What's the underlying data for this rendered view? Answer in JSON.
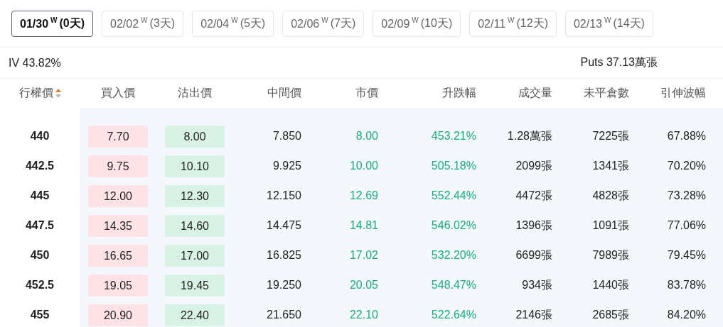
{
  "expiry_tabs": [
    {
      "date": "01/30",
      "mark": "W",
      "days": "(0天)",
      "selected": true
    },
    {
      "date": "02/02",
      "mark": "W",
      "days": "(3天)",
      "selected": false
    },
    {
      "date": "02/04",
      "mark": "W",
      "days": "(5天)",
      "selected": false
    },
    {
      "date": "02/06",
      "mark": "W",
      "days": "(7天)",
      "selected": false
    },
    {
      "date": "02/09",
      "mark": "W",
      "days": "(10天)",
      "selected": false
    },
    {
      "date": "02/11",
      "mark": "W",
      "days": "(12天)",
      "selected": false
    },
    {
      "date": "02/13",
      "mark": "W",
      "days": "(14天)",
      "selected": false
    }
  ],
  "summary": {
    "iv": "IV 43.82%",
    "puts": "Puts 37.13萬張"
  },
  "table": {
    "columns": [
      "行權價",
      "買入價",
      "沽出價",
      "中間價",
      "市價",
      "升跌幅",
      "成交量",
      "未平倉數",
      "引伸波幅"
    ],
    "rows": [
      [
        "440",
        "7.70",
        "8.00",
        "7.850",
        "8.00",
        "453.21%",
        "1.28萬張",
        "7225張",
        "67.88%"
      ],
      [
        "442.5",
        "9.75",
        "10.10",
        "9.925",
        "10.00",
        "505.18%",
        "2099張",
        "1341張",
        "70.20%"
      ],
      [
        "445",
        "12.00",
        "12.30",
        "12.150",
        "12.69",
        "552.44%",
        "4472張",
        "4828張",
        "73.28%"
      ],
      [
        "447.5",
        "14.35",
        "14.60",
        "14.475",
        "14.81",
        "546.02%",
        "1396張",
        "1091張",
        "77.06%"
      ],
      [
        "450",
        "16.65",
        "17.00",
        "16.825",
        "17.02",
        "532.20%",
        "6699張",
        "7989張",
        "79.45%"
      ],
      [
        "452.5",
        "19.05",
        "19.45",
        "19.250",
        "20.05",
        "548.47%",
        "934張",
        "1440張",
        "83.78%"
      ],
      [
        "455",
        "20.90",
        "22.40",
        "21.650",
        "22.10",
        "522.64%",
        "2146張",
        "2685張",
        "84.20%"
      ]
    ]
  }
}
